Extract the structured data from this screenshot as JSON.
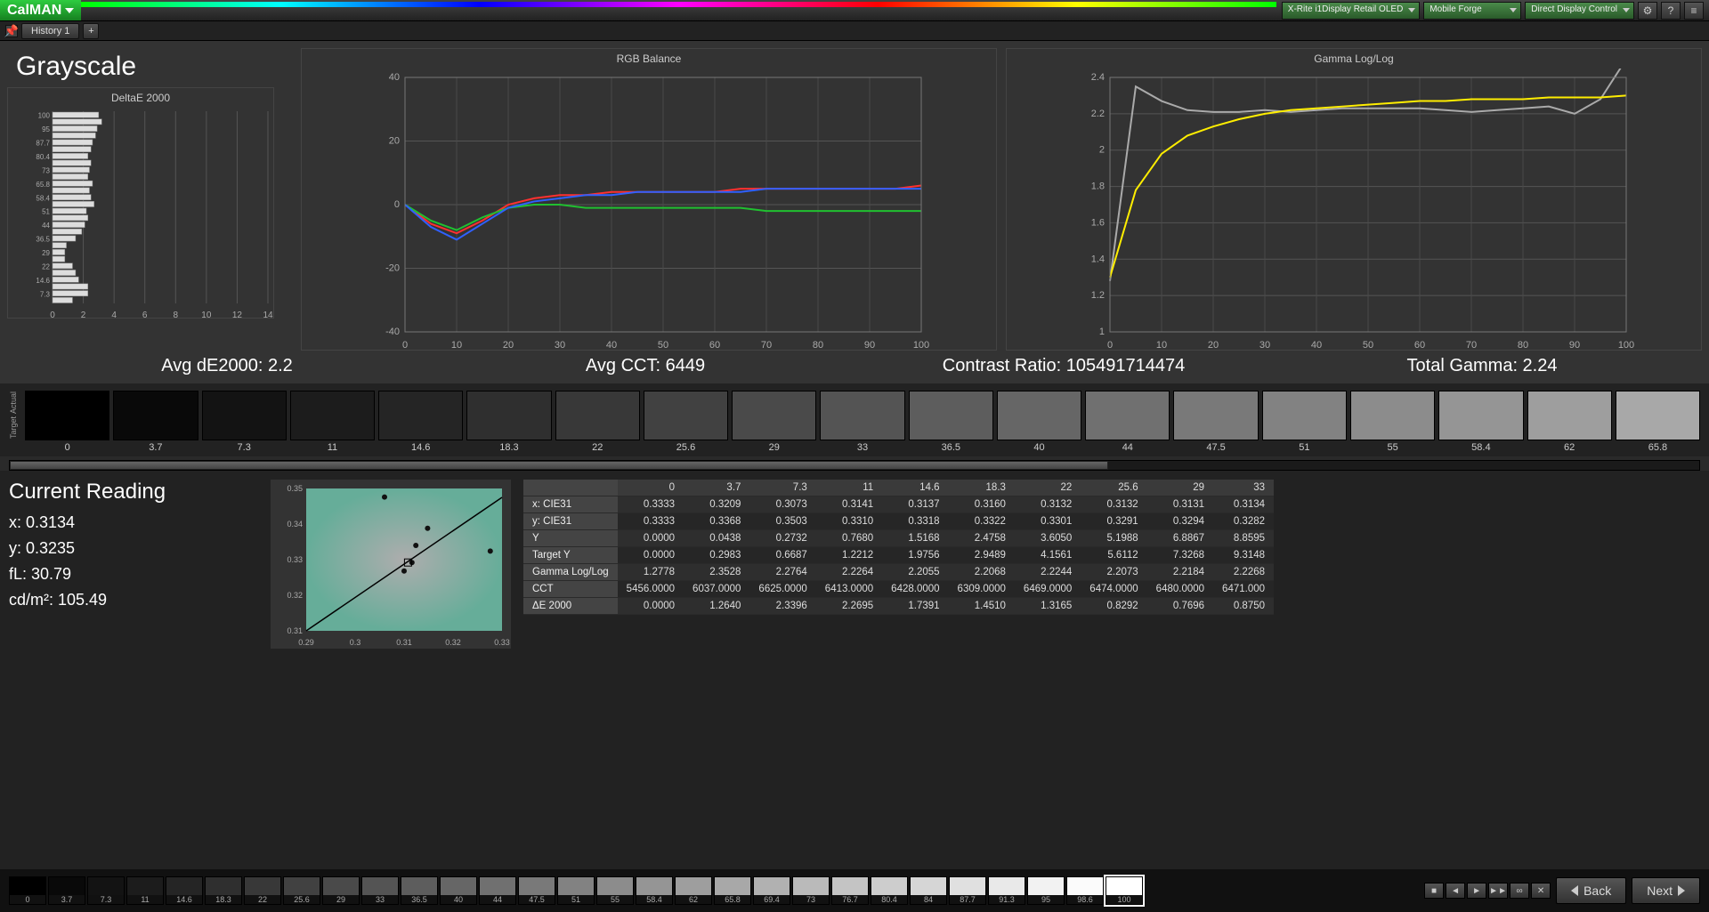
{
  "app": {
    "name": "CalMAN"
  },
  "toolbar": {
    "history_tab": "History 1",
    "dropdowns": [
      "X-Rite i1Display Retail OLED",
      "Mobile Forge",
      "Direct Display Control"
    ]
  },
  "page_title": "Grayscale",
  "stats": {
    "avg_de2000": "Avg dE2000: 2.2",
    "avg_cct": "Avg CCT: 6449",
    "contrast": "Contrast Ratio: 105491714474",
    "total_gamma": "Total Gamma: 2.24"
  },
  "swatch_axis_labels": {
    "top": "Actual",
    "bottom": "Target"
  },
  "swatches": [
    "0",
    "3.7",
    "7.3",
    "11",
    "14.6",
    "18.3",
    "22",
    "25.6",
    "29",
    "33",
    "36.5",
    "40",
    "44",
    "47.5",
    "51",
    "55",
    "58.4",
    "62",
    "65.8"
  ],
  "current_reading": {
    "title": "Current Reading",
    "x": "x: 0.3134",
    "y": "y: 0.3235",
    "fl": "fL: 30.79",
    "cdm2": "cd/m²: 105.49"
  },
  "table": {
    "headers": [
      "0",
      "3.7",
      "7.3",
      "11",
      "14.6",
      "18.3",
      "22",
      "25.6",
      "29",
      "33"
    ],
    "rows": [
      {
        "label": "x: CIE31",
        "cells": [
          "0.3333",
          "0.3209",
          "0.3073",
          "0.3141",
          "0.3137",
          "0.3160",
          "0.3132",
          "0.3132",
          "0.3131",
          "0.3134"
        ]
      },
      {
        "label": "y: CIE31",
        "cells": [
          "0.3333",
          "0.3368",
          "0.3503",
          "0.3310",
          "0.3318",
          "0.3322",
          "0.3301",
          "0.3291",
          "0.3294",
          "0.3282"
        ]
      },
      {
        "label": "Y",
        "cells": [
          "0.0000",
          "0.0438",
          "0.2732",
          "0.7680",
          "1.5168",
          "2.4758",
          "3.6050",
          "5.1988",
          "6.8867",
          "8.8595"
        ]
      },
      {
        "label": "Target Y",
        "cells": [
          "0.0000",
          "0.2983",
          "0.6687",
          "1.2212",
          "1.9756",
          "2.9489",
          "4.1561",
          "5.6112",
          "7.3268",
          "9.3148"
        ]
      },
      {
        "label": "Gamma Log/Log",
        "cells": [
          "1.2778",
          "2.3528",
          "2.2764",
          "2.2264",
          "2.2055",
          "2.2068",
          "2.2244",
          "2.2073",
          "2.2184",
          "2.2268"
        ]
      },
      {
        "label": "CCT",
        "cells": [
          "5456.0000",
          "6037.0000",
          "6625.0000",
          "6413.0000",
          "6428.0000",
          "6309.0000",
          "6469.0000",
          "6474.0000",
          "6480.0000",
          "6471.000"
        ]
      },
      {
        "label": "ΔE 2000",
        "cells": [
          "0.0000",
          "1.2640",
          "2.3396",
          "2.2695",
          "1.7391",
          "1.4510",
          "1.3165",
          "0.8292",
          "0.7696",
          "0.8750"
        ]
      }
    ]
  },
  "footer_swatches": [
    "0",
    "3.7",
    "7.3",
    "11",
    "14.6",
    "18.3",
    "22",
    "25.6",
    "29",
    "33",
    "36.5",
    "40",
    "44",
    "47.5",
    "51",
    "55",
    "58.4",
    "62",
    "65.8",
    "69.4",
    "73",
    "76.7",
    "80.4",
    "84",
    "87.7",
    "91.3",
    "95",
    "98.6",
    "100"
  ],
  "footer": {
    "back": "Back",
    "next": "Next"
  },
  "chart_data": [
    {
      "type": "bar",
      "title": "DeltaE 2000",
      "orientation": "horizontal",
      "categories": [
        "100",
        "98.6",
        "95",
        "91.3",
        "87.7",
        "84",
        "80.4",
        "76.7",
        "73",
        "69.4",
        "65.8",
        "62",
        "58.4",
        "55",
        "51",
        "47.5",
        "44",
        "40",
        "36.5",
        "33",
        "29",
        "25.6",
        "22",
        "18.3",
        "14.6",
        "11",
        "7.3",
        "3.7"
      ],
      "values": [
        3.0,
        3.2,
        2.9,
        2.8,
        2.6,
        2.5,
        2.3,
        2.5,
        2.4,
        2.3,
        2.6,
        2.4,
        2.5,
        2.7,
        2.2,
        2.3,
        2.1,
        1.9,
        1.5,
        0.9,
        0.8,
        0.8,
        1.3,
        1.5,
        1.7,
        2.3,
        2.3,
        1.3
      ],
      "xlim": [
        0,
        14
      ],
      "xticks": [
        0,
        2,
        4,
        6,
        8,
        10,
        12,
        14
      ]
    },
    {
      "type": "line",
      "title": "RGB Balance",
      "x": [
        0,
        5,
        10,
        15,
        20,
        25,
        30,
        35,
        40,
        45,
        50,
        55,
        60,
        65,
        70,
        75,
        80,
        85,
        90,
        95,
        100
      ],
      "series": [
        {
          "name": "Red",
          "color": "#ff3030",
          "values": [
            0,
            -6,
            -9,
            -5,
            0,
            2,
            3,
            3,
            4,
            4,
            4,
            4,
            4,
            5,
            5,
            5,
            5,
            5,
            5,
            5,
            6
          ]
        },
        {
          "name": "Green",
          "color": "#20c030",
          "values": [
            0,
            -5,
            -8,
            -4,
            -1,
            0,
            0,
            -1,
            -1,
            -1,
            -1,
            -1,
            -1,
            -1,
            -2,
            -2,
            -2,
            -2,
            -2,
            -2,
            -2
          ]
        },
        {
          "name": "Blue",
          "color": "#3060ff",
          "values": [
            0,
            -7,
            -11,
            -6,
            -1,
            1,
            2,
            3,
            3,
            4,
            4,
            4,
            4,
            4,
            5,
            5,
            5,
            5,
            5,
            5,
            5
          ]
        }
      ],
      "ylim": [
        -40,
        40
      ],
      "xlim": [
        0,
        100
      ],
      "yticks": [
        -40,
        -20,
        0,
        20,
        40
      ],
      "xticks": [
        0,
        10,
        20,
        30,
        40,
        50,
        60,
        70,
        80,
        90,
        100
      ]
    },
    {
      "type": "line",
      "title": "Gamma Log/Log",
      "x": [
        0,
        5,
        10,
        15,
        20,
        25,
        30,
        35,
        40,
        45,
        50,
        55,
        60,
        65,
        70,
        75,
        80,
        85,
        90,
        95,
        100
      ],
      "series": [
        {
          "name": "Measured",
          "color": "#aaaaaa",
          "values": [
            1.28,
            2.35,
            2.27,
            2.22,
            2.21,
            2.21,
            2.22,
            2.21,
            2.22,
            2.23,
            2.23,
            2.23,
            2.23,
            2.22,
            2.21,
            2.22,
            2.23,
            2.24,
            2.2,
            2.28,
            2.5
          ]
        },
        {
          "name": "Target",
          "color": "#ffee00",
          "values": [
            1.3,
            1.78,
            1.98,
            2.08,
            2.13,
            2.17,
            2.2,
            2.22,
            2.23,
            2.24,
            2.25,
            2.26,
            2.27,
            2.27,
            2.28,
            2.28,
            2.28,
            2.29,
            2.29,
            2.29,
            2.3
          ]
        }
      ],
      "ylim": [
        1.0,
        2.4
      ],
      "xlim": [
        0,
        100
      ],
      "yticks": [
        1.0,
        1.2,
        1.4,
        1.6,
        1.8,
        2.0,
        2.2,
        2.4
      ],
      "xticks": [
        0,
        10,
        20,
        30,
        40,
        50,
        60,
        70,
        80,
        90,
        100
      ]
    }
  ]
}
